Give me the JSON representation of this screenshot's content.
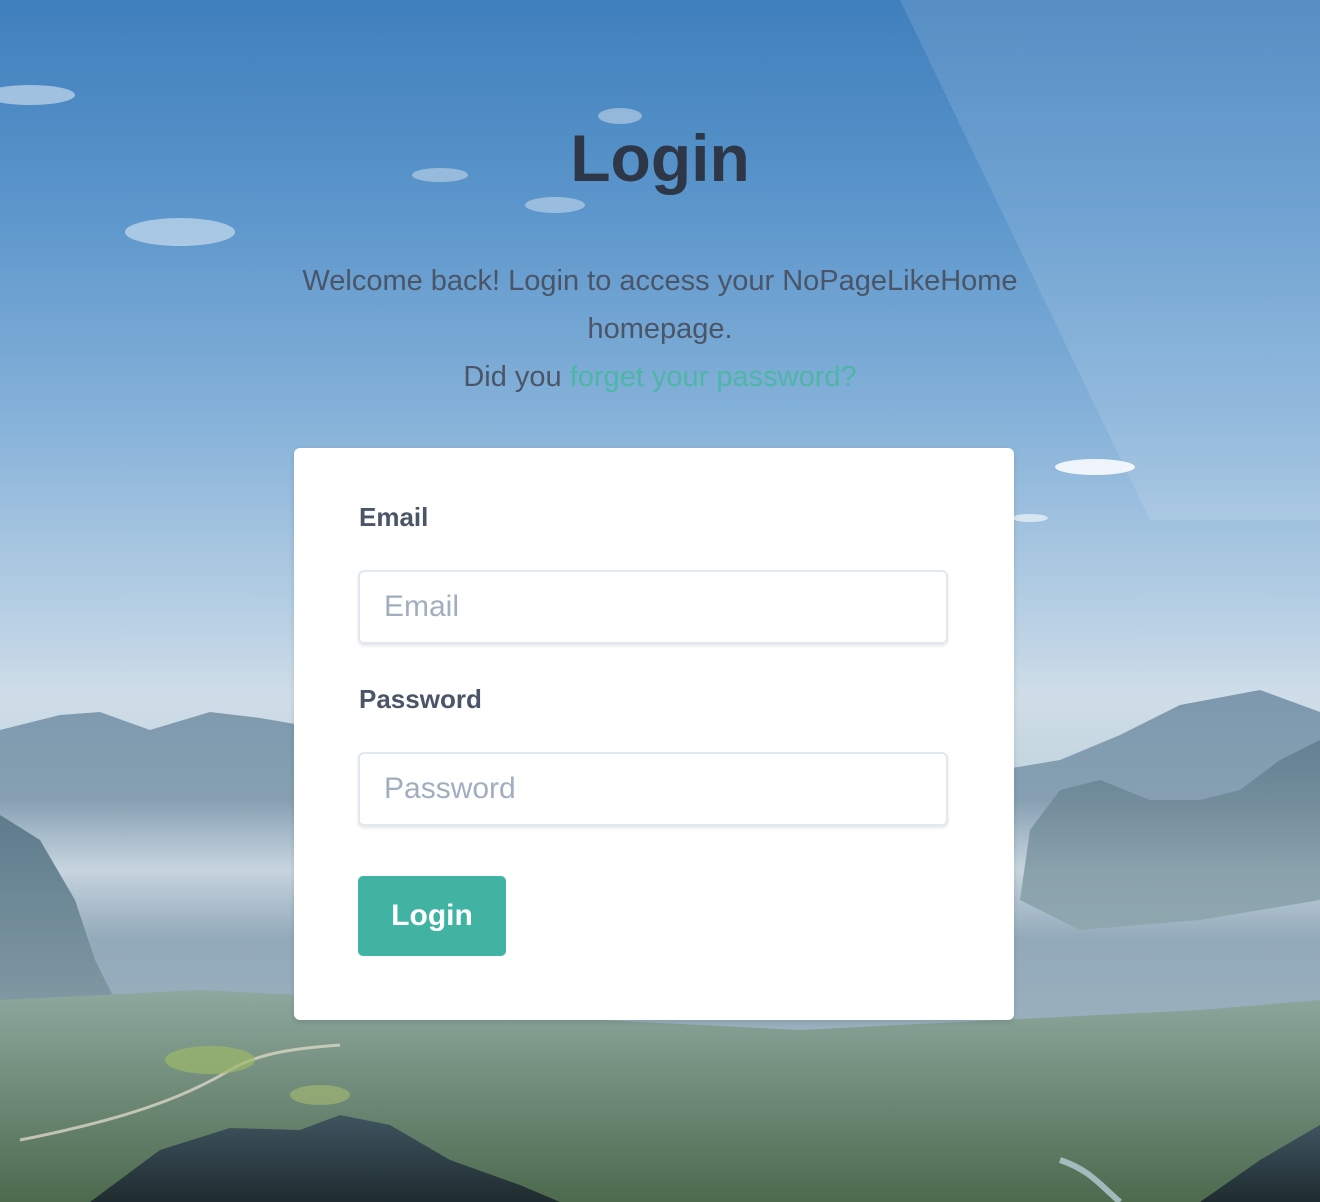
{
  "page": {
    "title": "Login",
    "intro_line1": "Welcome back! Login to access your NoPageLikeHome homepage.",
    "intro_prefix": "Did you",
    "forgot_link": "forget your password?"
  },
  "form": {
    "email_label": "Email",
    "email_placeholder": "Email",
    "email_value": "",
    "password_label": "Password",
    "password_placeholder": "Password",
    "password_value": "",
    "submit_label": "Login"
  },
  "colors": {
    "accent": "#41b3a3",
    "link": "#4db6a6",
    "heading": "#2d3748",
    "text": "#4a5568"
  }
}
